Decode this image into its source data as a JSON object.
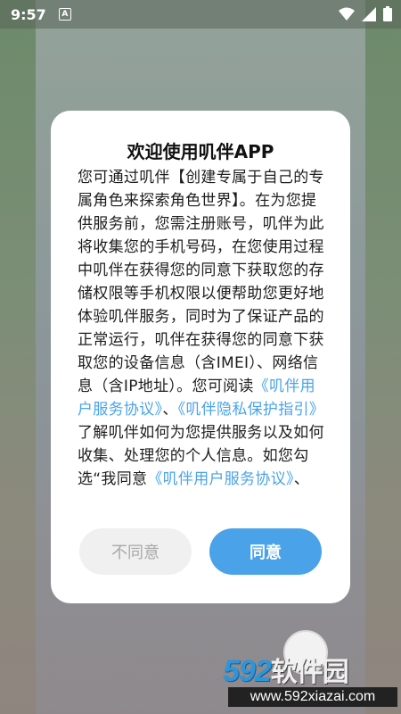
{
  "status_bar": {
    "time": "9:57",
    "notification_icon_letter": "A",
    "icons": [
      "wifi-icon",
      "signal-icon",
      "battery-icon"
    ]
  },
  "dialog": {
    "title": "欢迎使用叽伴APP",
    "body": {
      "part1": "您可通过叽伴【创建专属于自己的专属角色来探索角色世界】。在为您提供服务前，您需注册账号，叽伴为此将收集您的手机号码，在您使用过程中叽伴在获得您的同意下获取您的存储权限等手机权限以便帮助您更好地体验叽伴服务，同时为了保证产品的正常运行，叽伴在获得您的同意下获取您的设备信息（含IMEI）、网络信息（含IP地址）。您可阅读",
      "link1": "《叽伴用户服务协议》",
      "part2": "、",
      "link2": "《叽伴隐私保护指引》",
      "part3": "了解叽伴如何为您提供服务以及如何收集、处理您的个人信息。如您勾选“我同意",
      "link3": "《叽伴用户服务协议》",
      "part4": "、"
    },
    "disagree_label": "不同意",
    "agree_label": "同意"
  },
  "watermark": {
    "logo_number": "592",
    "logo_text": "软件园",
    "url": "www.592xiazai.com"
  },
  "colors": {
    "accent": "#4aa3e8",
    "disagree_bg": "#f0f0f0",
    "disagree_text": "#a8a8a8"
  }
}
